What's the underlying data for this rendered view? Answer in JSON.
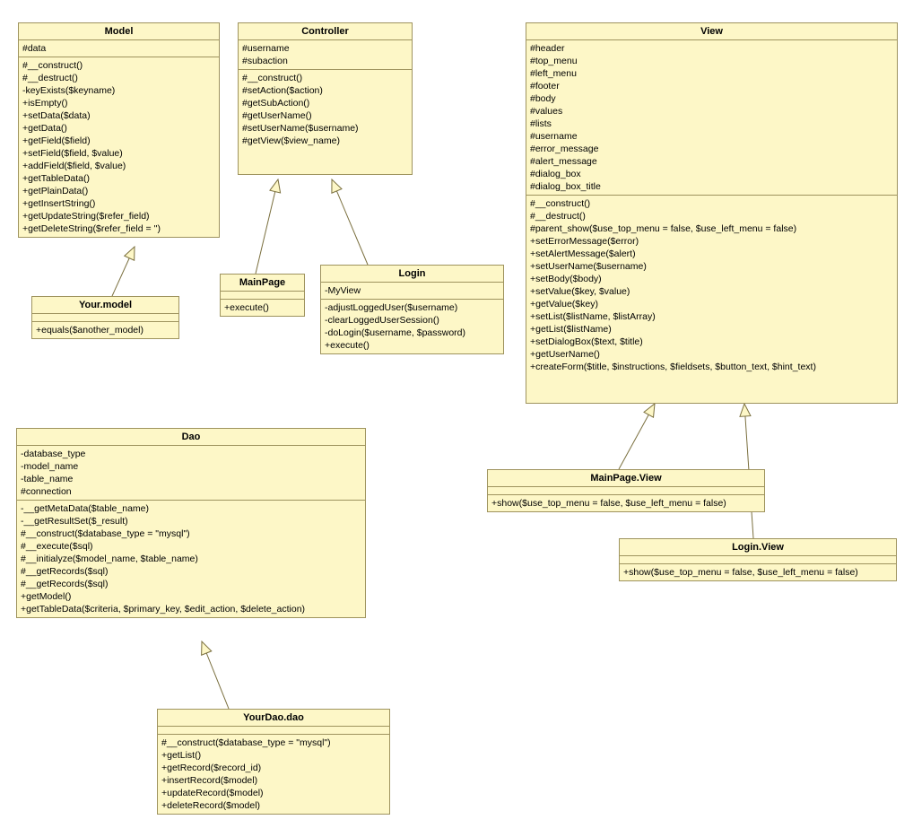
{
  "classes": {
    "model": {
      "title": "Model",
      "attributes": [
        "#data"
      ],
      "methods": [
        "#__construct()",
        "#__destruct()",
        "-keyExists($keyname)",
        "+isEmpty()",
        "+setData($data)",
        "+getData()",
        "+getField($field)",
        "+setField($field, $value)",
        "+addField($field, $value)",
        "+getTableData()",
        "+getPlainData()",
        "+getInsertString()",
        "+getUpdateString($refer_field)",
        "+getDeleteString($refer_field = '')"
      ]
    },
    "controller": {
      "title": "Controller",
      "attributes": [
        "#username",
        "#subaction"
      ],
      "methods": [
        "#__construct()",
        "#setAction($action)",
        "#getSubAction()",
        "#getUserName()",
        "#setUserName($username)",
        "#getView($view_name)"
      ]
    },
    "view": {
      "title": "View",
      "attributes": [
        "#header",
        "#top_menu",
        "#left_menu",
        "#footer",
        "#body",
        "#values",
        "#lists",
        "#username",
        "#error_message",
        "#alert_message",
        "#dialog_box",
        "#dialog_box_title"
      ],
      "methods": [
        "#__construct()",
        "#__destruct()",
        "#parent_show($use_top_menu = false, $use_left_menu = false)",
        "+setErrorMessage($error)",
        "+setAlertMessage($alert)",
        "+setUserName($username)",
        "+setBody($body)",
        "+setValue($key, $value)",
        "+getValue($key)",
        "+setList($listName, $listArray)",
        "+getList($listName)",
        "+setDialogBox($text, $title)",
        "+getUserName()",
        "+createForm($title, $instructions, $fieldsets, $button_text, $hint_text)"
      ]
    },
    "yourmodel": {
      "title": "Your.model",
      "attributes": [],
      "methods": [
        "+equals($another_model)"
      ]
    },
    "mainpage": {
      "title": "MainPage",
      "attributes": [],
      "methods": [
        "+execute()"
      ]
    },
    "login": {
      "title": "Login",
      "attributes": [
        "-MyView"
      ],
      "methods": [
        "-adjustLoggedUser($username)",
        "-clearLoggedUserSession()",
        "-doLogin($username, $password)",
        "+execute()"
      ]
    },
    "dao": {
      "title": "Dao",
      "attributes": [
        "-database_type",
        "-model_name",
        "-table_name",
        "#connection"
      ],
      "methods": [
        "-__getMetaData($table_name)",
        "-__getResultSet($_result)",
        "#__construct($database_type = \"mysql\")",
        "#__execute($sql)",
        "#__initialyze($model_name, $table_name)",
        "#__getRecords($sql)",
        "#__getRecords($sql)",
        "+getModel()",
        "+getTableData($criteria, $primary_key, $edit_action, $delete_action)"
      ]
    },
    "yourdao": {
      "title": "YourDao.dao",
      "attributes": [],
      "methods": [
        "#__construct($database_type = \"mysql\")",
        "+getList()",
        "+getRecord($record_id)",
        "+insertRecord($model)",
        "+updateRecord($model)",
        "+deleteRecord($model)"
      ]
    },
    "mainpageview": {
      "title": "MainPage.View",
      "attributes": [],
      "methods": [
        "+show($use_top_menu = false, $use_left_menu = false)"
      ]
    },
    "loginview": {
      "title": "Login.View",
      "attributes": [],
      "methods": [
        "+show($use_top_menu = false, $use_left_menu = false)"
      ]
    }
  }
}
